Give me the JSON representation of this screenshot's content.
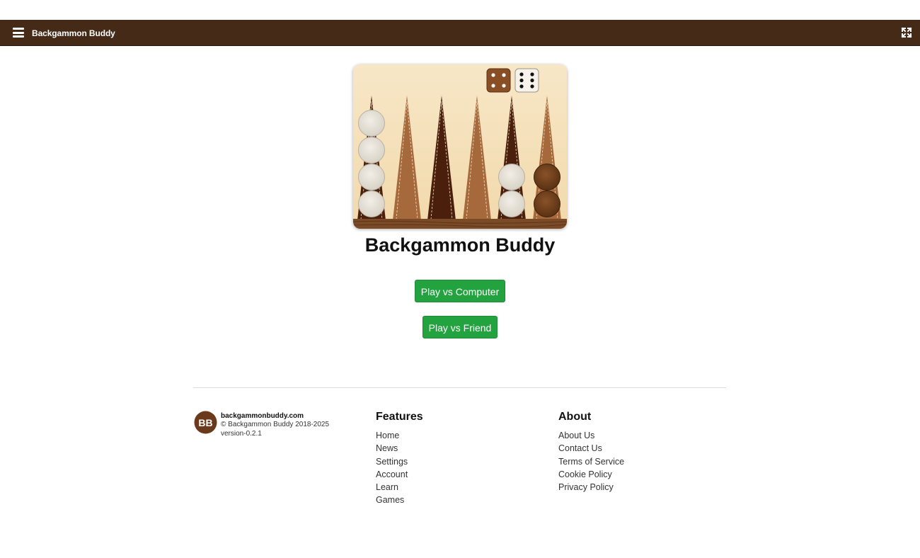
{
  "navbar": {
    "brand": "Backgammon Buddy",
    "menu_icon": "hamburger-menu-icon",
    "fullscreen_icon": "fullscreen-icon",
    "background": "#452a17"
  },
  "hero": {
    "title": "Backgammon Buddy",
    "dice": [
      4,
      6
    ]
  },
  "buttons": {
    "play_computer": "Play vs Computer",
    "play_friend": "Play vs Friend",
    "color": "#23a340"
  },
  "footer": {
    "logo_text": "BB",
    "site": "backgammonbuddy.com",
    "copyright": "© Backgammon Buddy 2018-2025",
    "version": "version-0.2.1",
    "features": {
      "heading": "Features",
      "links": [
        "Home",
        "News",
        "Settings",
        "Account",
        "Learn",
        "Games"
      ]
    },
    "about": {
      "heading": "About",
      "links": [
        "About Us",
        "Contact Us",
        "Terms of Service",
        "Cookie Policy",
        "Privacy Policy"
      ]
    }
  }
}
